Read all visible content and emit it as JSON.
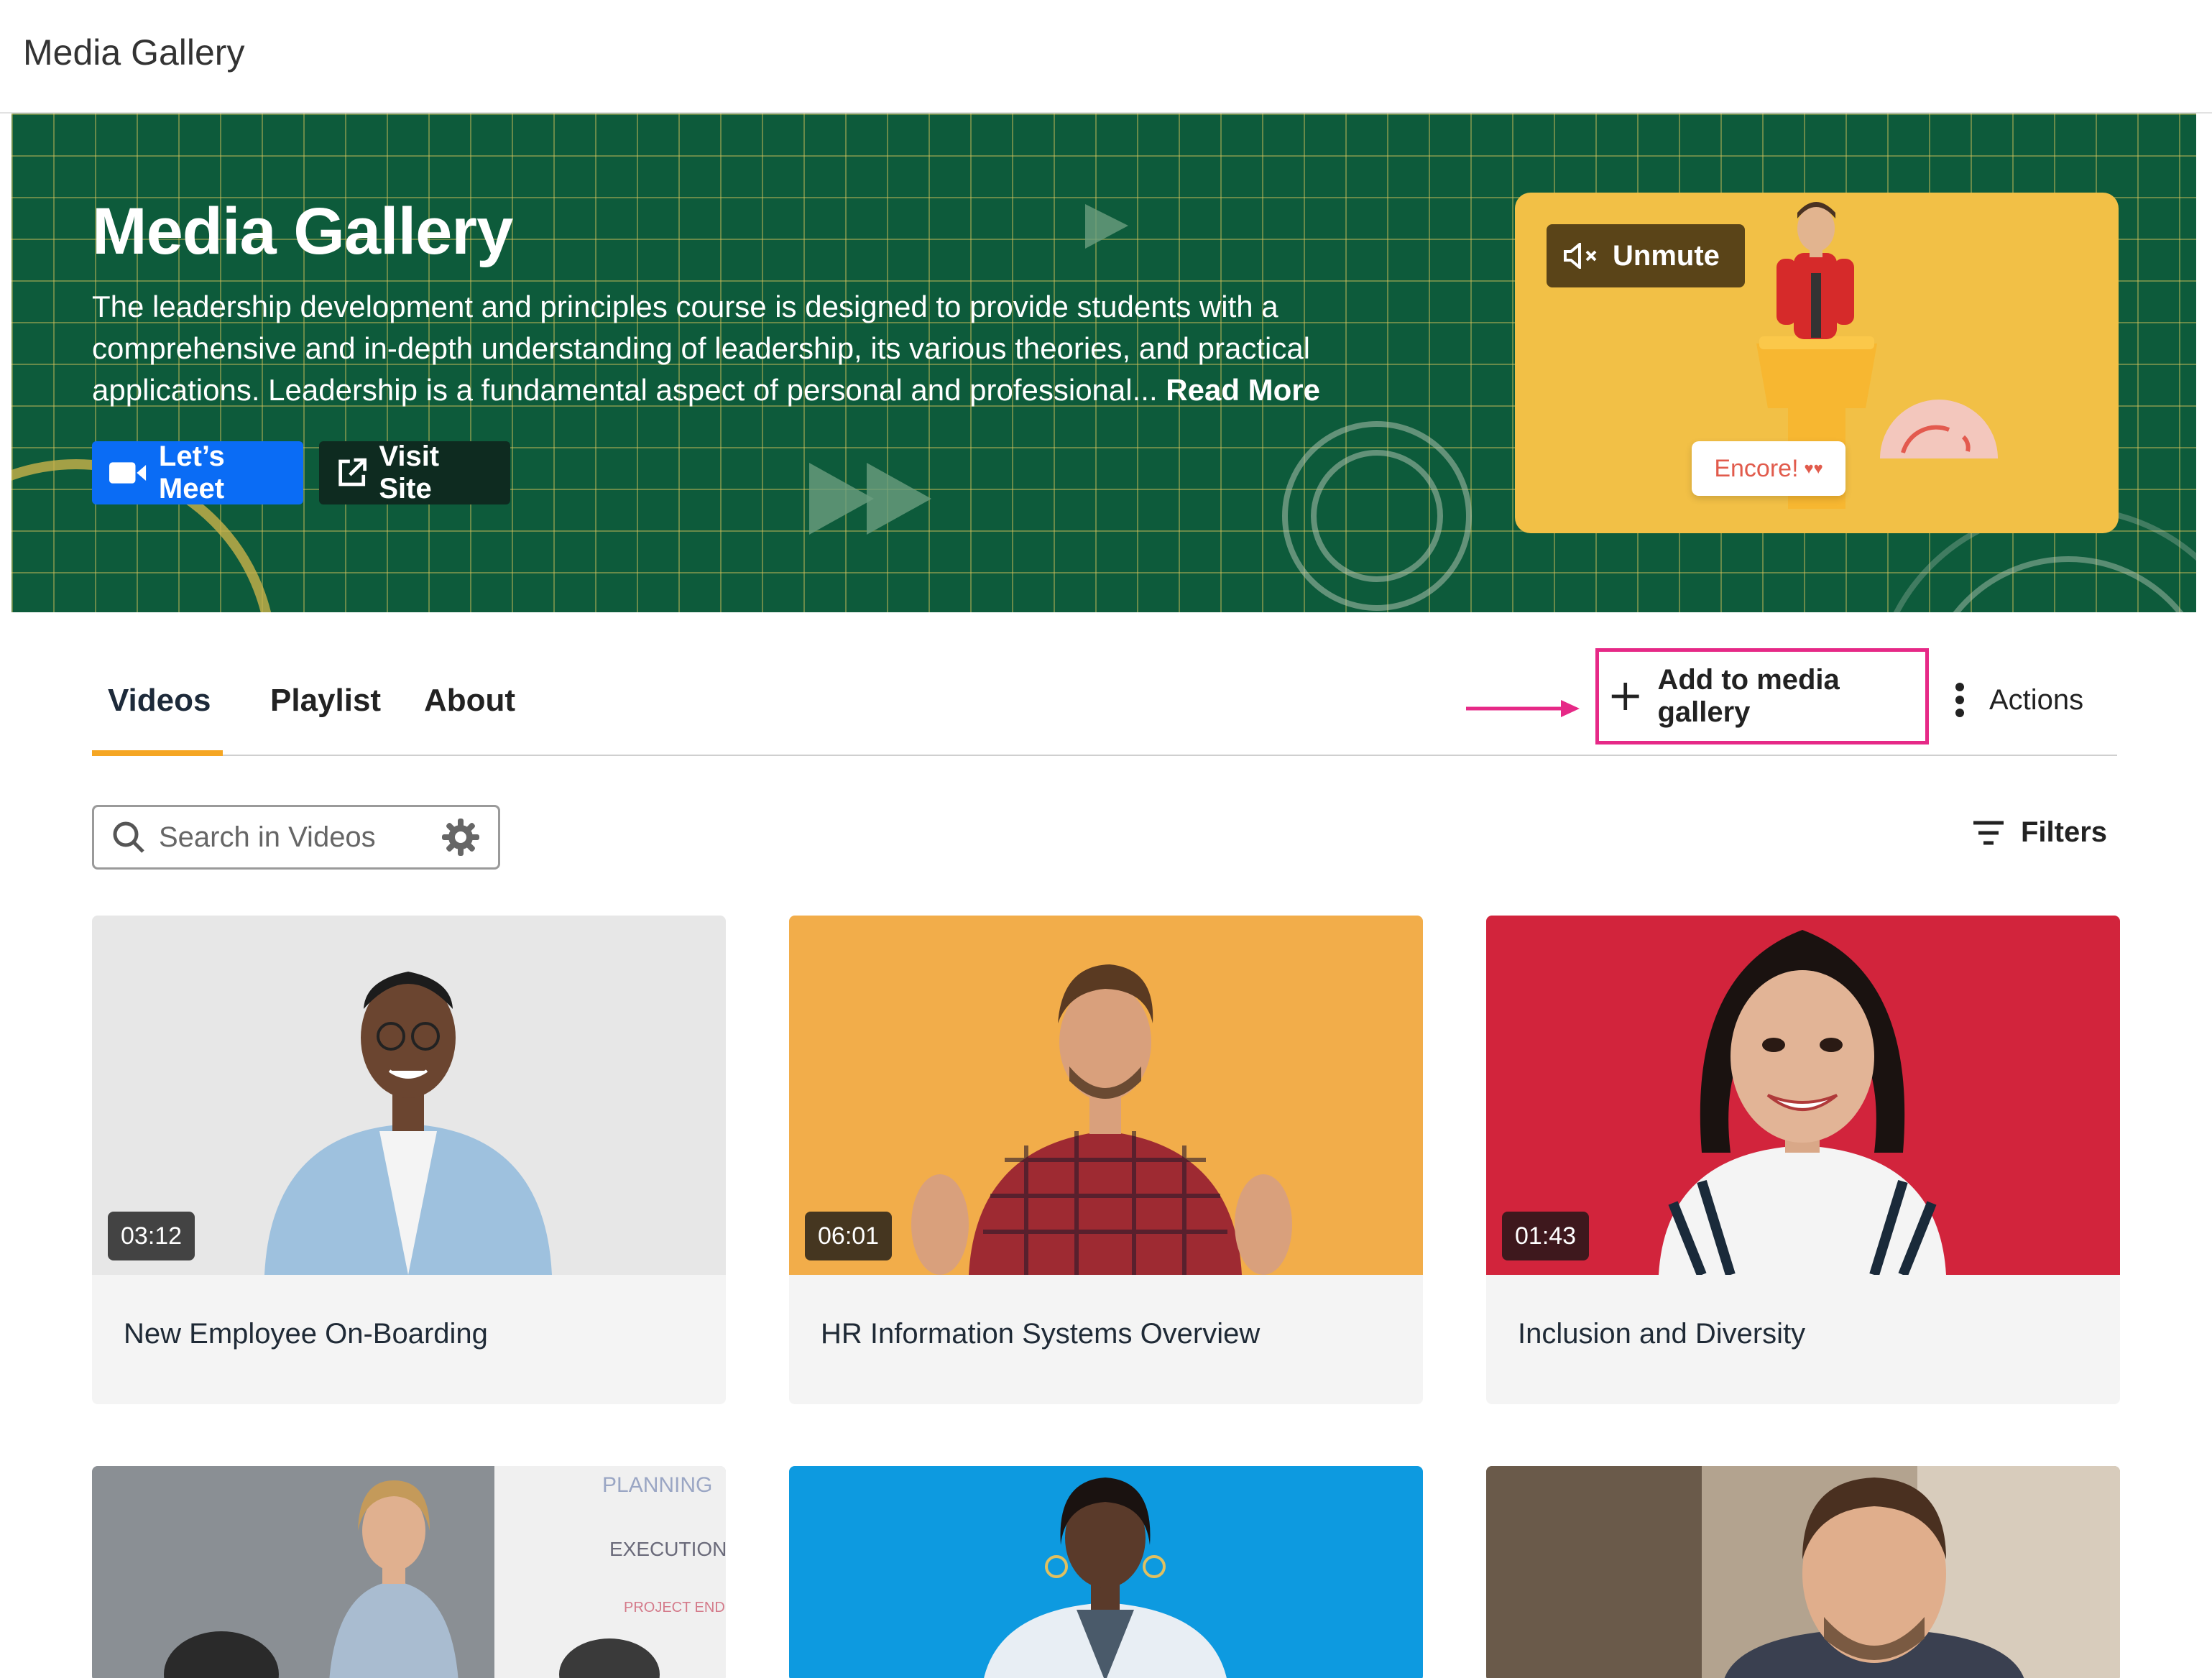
{
  "header": {
    "title": "Media Gallery"
  },
  "hero": {
    "title": "Media Gallery",
    "description": "The leadership development and principles course is designed to provide students with a comprehensive and in-depth understanding of leadership, its various theories, and practical applications. Leadership is a fundamental aspect of personal and professional...",
    "read_more": "Read More",
    "meet_button": "Let’s Meet",
    "visit_button": "Visit Site",
    "video": {
      "unmute_label": "Unmute",
      "speech_bubble": "Encore!"
    }
  },
  "tabs": [
    {
      "label": "Videos",
      "active": true
    },
    {
      "label": "Playlist",
      "active": false
    },
    {
      "label": "About",
      "active": false
    }
  ],
  "toolbar": {
    "add_label": "Add to media gallery",
    "actions_label": "Actions"
  },
  "search": {
    "placeholder": "Search in Videos"
  },
  "filters": {
    "label": "Filters"
  },
  "videos": [
    {
      "title": "New Employee On-Boarding",
      "duration": "03:12",
      "bg": "#e7e7e7"
    },
    {
      "title": "HR Information Systems Overview",
      "duration": "06:01",
      "bg": "#f2ad4a"
    },
    {
      "title": "Inclusion and Diversity",
      "duration": "01:43",
      "bg": "#d2243c"
    },
    {
      "title": "",
      "duration": "",
      "bg": "#d9d9d9"
    },
    {
      "title": "",
      "duration": "",
      "bg": "#0d9ae0"
    },
    {
      "title": "",
      "duration": "",
      "bg": "#b3a38f"
    }
  ],
  "whiteboard": [
    "PLANNING",
    "EXECUTION",
    "PROJECT END"
  ],
  "colors": {
    "hero_bg": "#0d5b3b",
    "accent_tab": "#f5a623",
    "highlight": "#e62987",
    "meet_button": "#0a6cf5"
  }
}
